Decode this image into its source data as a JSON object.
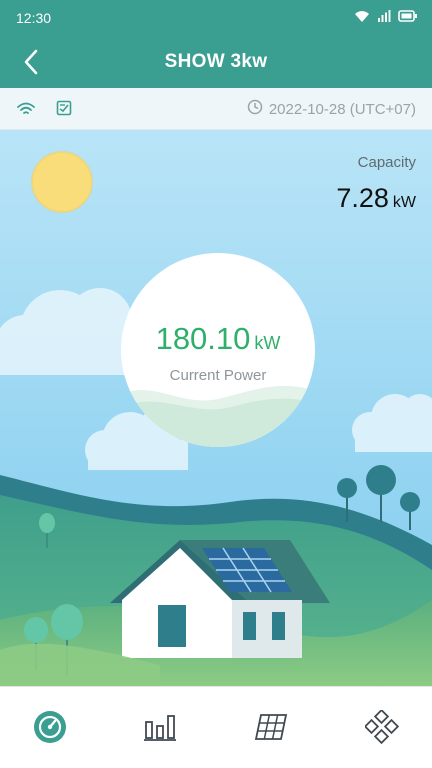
{
  "status_bar": {
    "time": "12:30",
    "icons": [
      "wifi-icon",
      "signal-icon",
      "battery-icon"
    ]
  },
  "header": {
    "title": "SHOW 3kw",
    "back_icon": "chevron-left-icon",
    "background_color": "#3a9e91"
  },
  "info_bar": {
    "icons": [
      "wifi-icon",
      "datalogger-icon",
      "clock-icon"
    ],
    "date": "2022-10-28 (UTC+07)"
  },
  "capacity": {
    "label": "Capacity",
    "value": "7.28",
    "unit": "kW"
  },
  "current_power": {
    "value": "180.10",
    "unit": "kW",
    "label": "Current Power",
    "color": "#2fb06a"
  },
  "tab_bar": {
    "active_index": 0,
    "active_color": "#3a9e91",
    "tabs": [
      {
        "icon": "dashboard-gauge-icon"
      },
      {
        "icon": "bar-chart-icon"
      },
      {
        "icon": "solar-panel-icon"
      },
      {
        "icon": "device-grid-icon"
      }
    ]
  }
}
